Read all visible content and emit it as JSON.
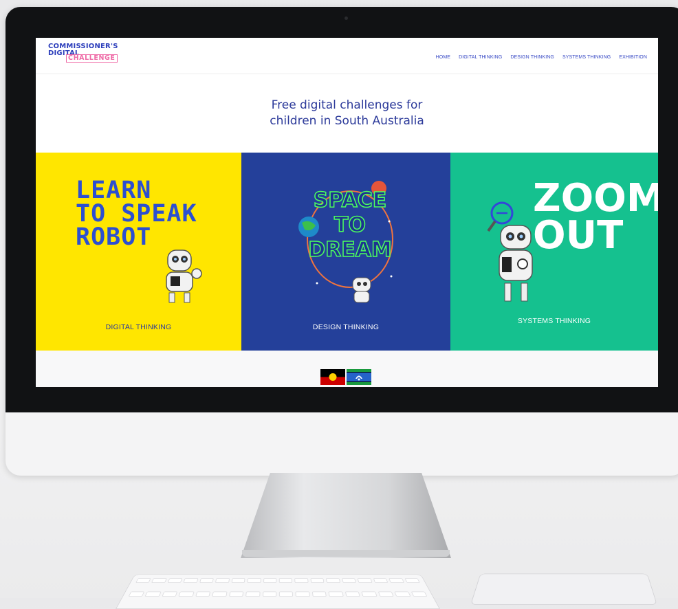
{
  "site": {
    "logo": {
      "line1": "COMMISSIONER'S",
      "line2": "DIGITAL",
      "line3": "CHALLENGE"
    },
    "nav": [
      "HOME",
      "DIGITAL THINKING",
      "DESIGN THINKING",
      "SYSTEMS THINKING",
      "EXHIBITION"
    ],
    "hero_title": "Free digital challenges for\nchildren in South Australia",
    "tiles": [
      {
        "art_text": "LEARN\nTO SPEAK\nROBOT",
        "label": "DIGITAL THINKING",
        "color": "#ffe600"
      },
      {
        "art_text": "SPACE\nTO\nDREAM",
        "label": "DESIGN THINKING",
        "color": "#24409a"
      },
      {
        "art_text": "ZOOM\nOUT",
        "label": "SYSTEMS THINKING",
        "color": "#15c18f"
      }
    ],
    "flags": [
      "aboriginal-flag",
      "torres-strait-islander-flag"
    ]
  },
  "colors": {
    "accent": "#2b3dbb",
    "pink": "#ef6aa6"
  }
}
